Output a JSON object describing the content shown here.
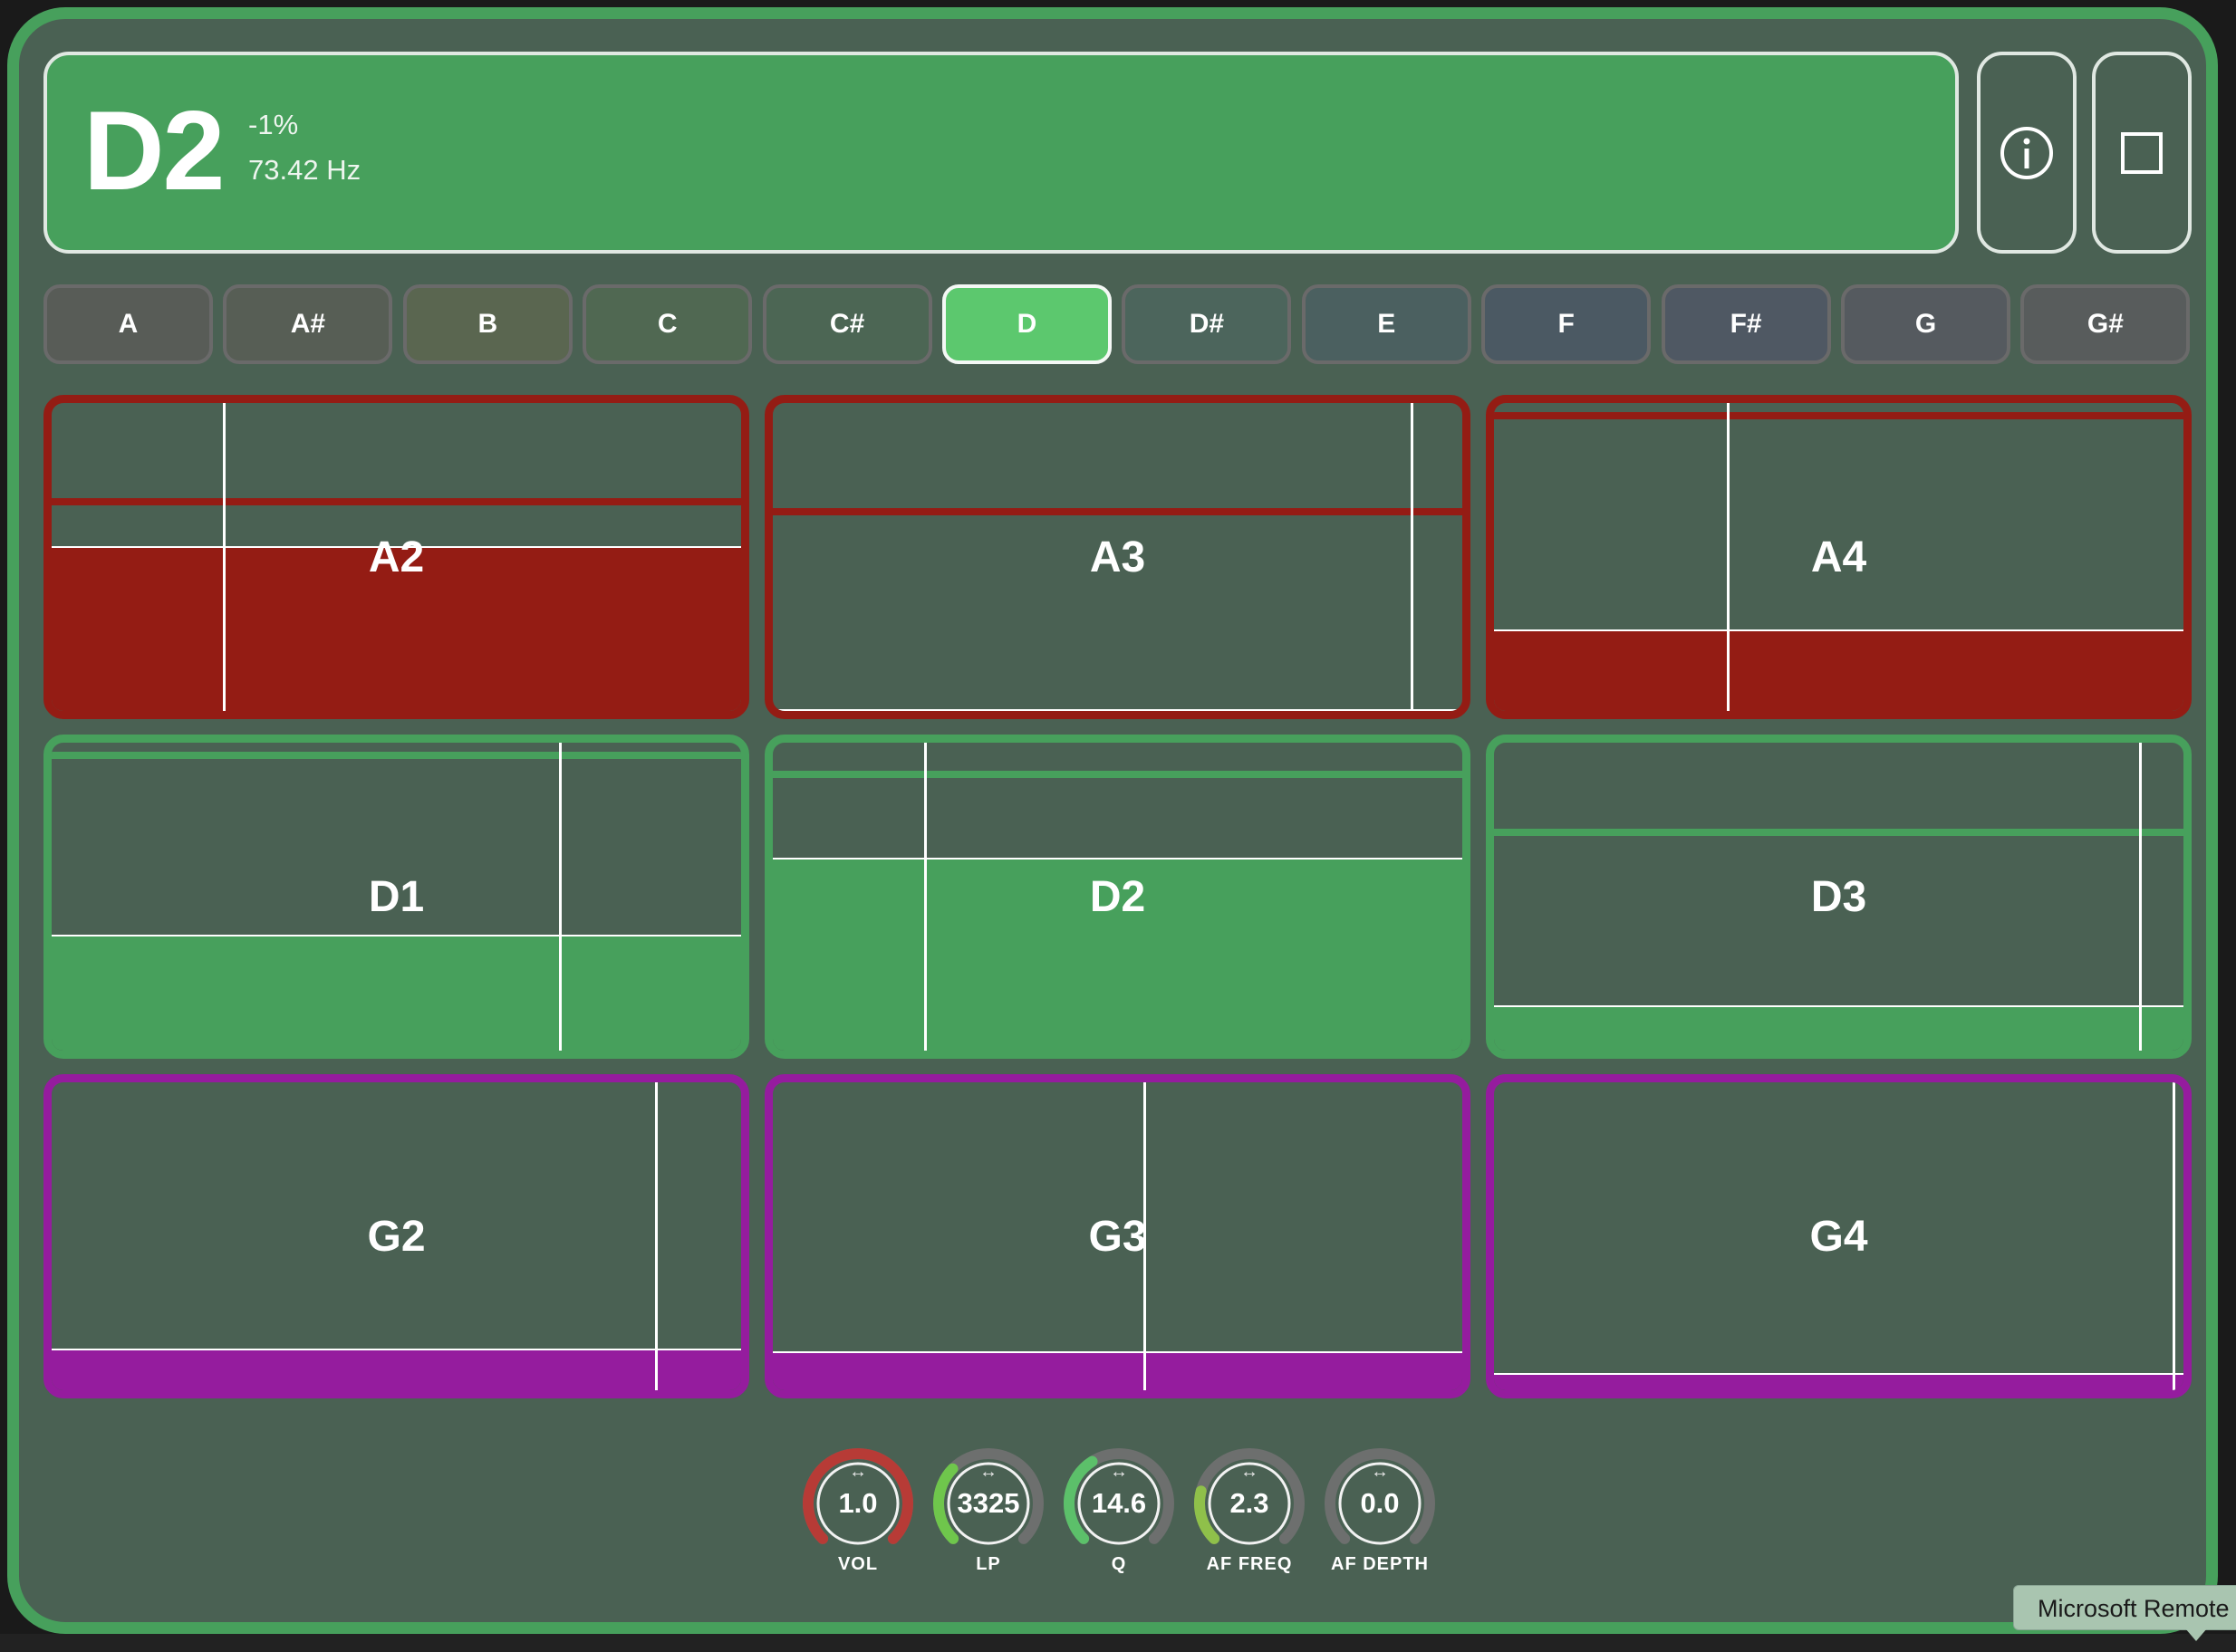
{
  "header": {
    "note": "D2",
    "cents": "-1%",
    "frequency": "73.42 Hz"
  },
  "note_selector": {
    "selected": "D",
    "keys": [
      {
        "label": "A",
        "color": "#585c57"
      },
      {
        "label": "A#",
        "color": "#575e55"
      },
      {
        "label": "B",
        "color": "#5a6650"
      },
      {
        "label": "C",
        "color": "#506852"
      },
      {
        "label": "C#",
        "color": "#4c6654"
      },
      {
        "label": "D",
        "color": "#5cc86e"
      },
      {
        "label": "D#",
        "color": "#4c655c"
      },
      {
        "label": "E",
        "color": "#4b6060"
      },
      {
        "label": "F",
        "color": "#4b5963"
      },
      {
        "label": "F#",
        "color": "#4f5863"
      },
      {
        "label": "G",
        "color": "#555a5f"
      },
      {
        "label": "G#",
        "color": "#585c5c"
      }
    ]
  },
  "colors": {
    "accent_green": "#47a05c",
    "red": "#941c14",
    "purple": "#951c9e",
    "panel": "#4a6153"
  },
  "pads": [
    {
      "label": "A2",
      "color": "#941c14",
      "level": 0.53,
      "band": 0.69,
      "marker": 0.25
    },
    {
      "label": "A3",
      "color": "#941c14",
      "level": 0.0,
      "band": 0.66,
      "marker": 0.93
    },
    {
      "label": "A4",
      "color": "#941c14",
      "level": 0.26,
      "band": 0.97,
      "marker": 0.34
    },
    {
      "label": "D1",
      "color": "#47a05c",
      "level": 0.37,
      "band": 0.97,
      "marker": 0.74
    },
    {
      "label": "D2",
      "color": "#47a05c",
      "level": 0.62,
      "band": 0.91,
      "marker": 0.22
    },
    {
      "label": "D3",
      "color": "#47a05c",
      "level": 0.14,
      "band": 0.72,
      "marker": 0.94
    },
    {
      "label": "G2",
      "color": "#951c9e",
      "level": 0.13,
      "band": 0.0,
      "marker": 0.88
    },
    {
      "label": "G3",
      "color": "#951c9e",
      "level": 0.12,
      "band": 0.0,
      "marker": 0.54
    },
    {
      "label": "G4",
      "color": "#951c9e",
      "level": 0.05,
      "band": 0.0,
      "marker": 0.99
    }
  ],
  "knobs": [
    {
      "value": "1.0",
      "label": "VOL",
      "fraction": 1.0,
      "color": "#b73b36"
    },
    {
      "value": "3325",
      "label": "LP",
      "fraction": 0.33,
      "color": "#6fc64c"
    },
    {
      "value": "14.6",
      "label": "Q",
      "fraction": 0.38,
      "color": "#5cc06a"
    },
    {
      "value": "2.3",
      "label": "AF FREQ",
      "fraction": 0.22,
      "color": "#8fc04a"
    },
    {
      "value": "0.0",
      "label": "AF DEPTH",
      "fraction": 0.0,
      "color": "#7a7a7a"
    }
  ],
  "knob_arrow": "↔",
  "tooltip": "Microsoft Remote"
}
